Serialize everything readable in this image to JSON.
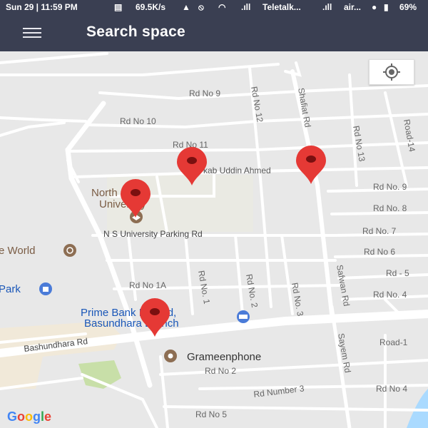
{
  "status_bar": {
    "datetime": "Sun 29 | 11:59 PM",
    "speed": "69.5K/s",
    "carrier1": "Teletalk...",
    "carrier2": "air...",
    "battery": "69%"
  },
  "app_bar": {
    "menu_icon": "hamburger-menu-icon",
    "title": "Search space"
  },
  "map": {
    "locate_icon": "my-location-icon",
    "logo": "Google",
    "roads": {
      "rd9": "Rd No 9",
      "rd10": "Rd No 10",
      "rd11": "Rd No 11",
      "rd12": "Rd No 12",
      "rd13": "Rd No 13",
      "road14": "Road-14",
      "shafiat": "Shafiat Rd",
      "kab": "kab Uddin Ahmed",
      "e9": "Rd No. 9",
      "e8": "Rd No. 8",
      "e7": "Rd No. 7",
      "e6": "Rd No 6",
      "e5": "Rd - 5",
      "e4": "Rd No. 4",
      "ns_parking": "N S University Parking Rd",
      "rd1a": "Rd No 1A",
      "rdno1": "Rd No. 1",
      "rdno2": "Rd No. 2",
      "rdno3": "Rd No. 3",
      "safwan": "Safwan Rd",
      "bashundhara": "Bashundhara Rd",
      "road1": "Road-1",
      "sayem": "Sayem Rd",
      "s2": "Rd No 2",
      "s3": "Rd Number 3",
      "s4": "Rd No 4",
      "s5": "Rd No 5"
    },
    "poi": {
      "nsu_line1": "North South",
      "nsu_line2": "University",
      "world": "e World",
      "park": "Park",
      "bank_line1": "Prime Bank Limited,",
      "bank_line2": "Basundhara Branch",
      "grameen": "Grameenphone"
    },
    "markers": [
      {
        "name": "marker-1",
        "color": "#e53935"
      },
      {
        "name": "marker-2",
        "color": "#e53935"
      },
      {
        "name": "marker-3",
        "color": "#e53935"
      },
      {
        "name": "marker-4",
        "color": "#e53935"
      }
    ]
  }
}
